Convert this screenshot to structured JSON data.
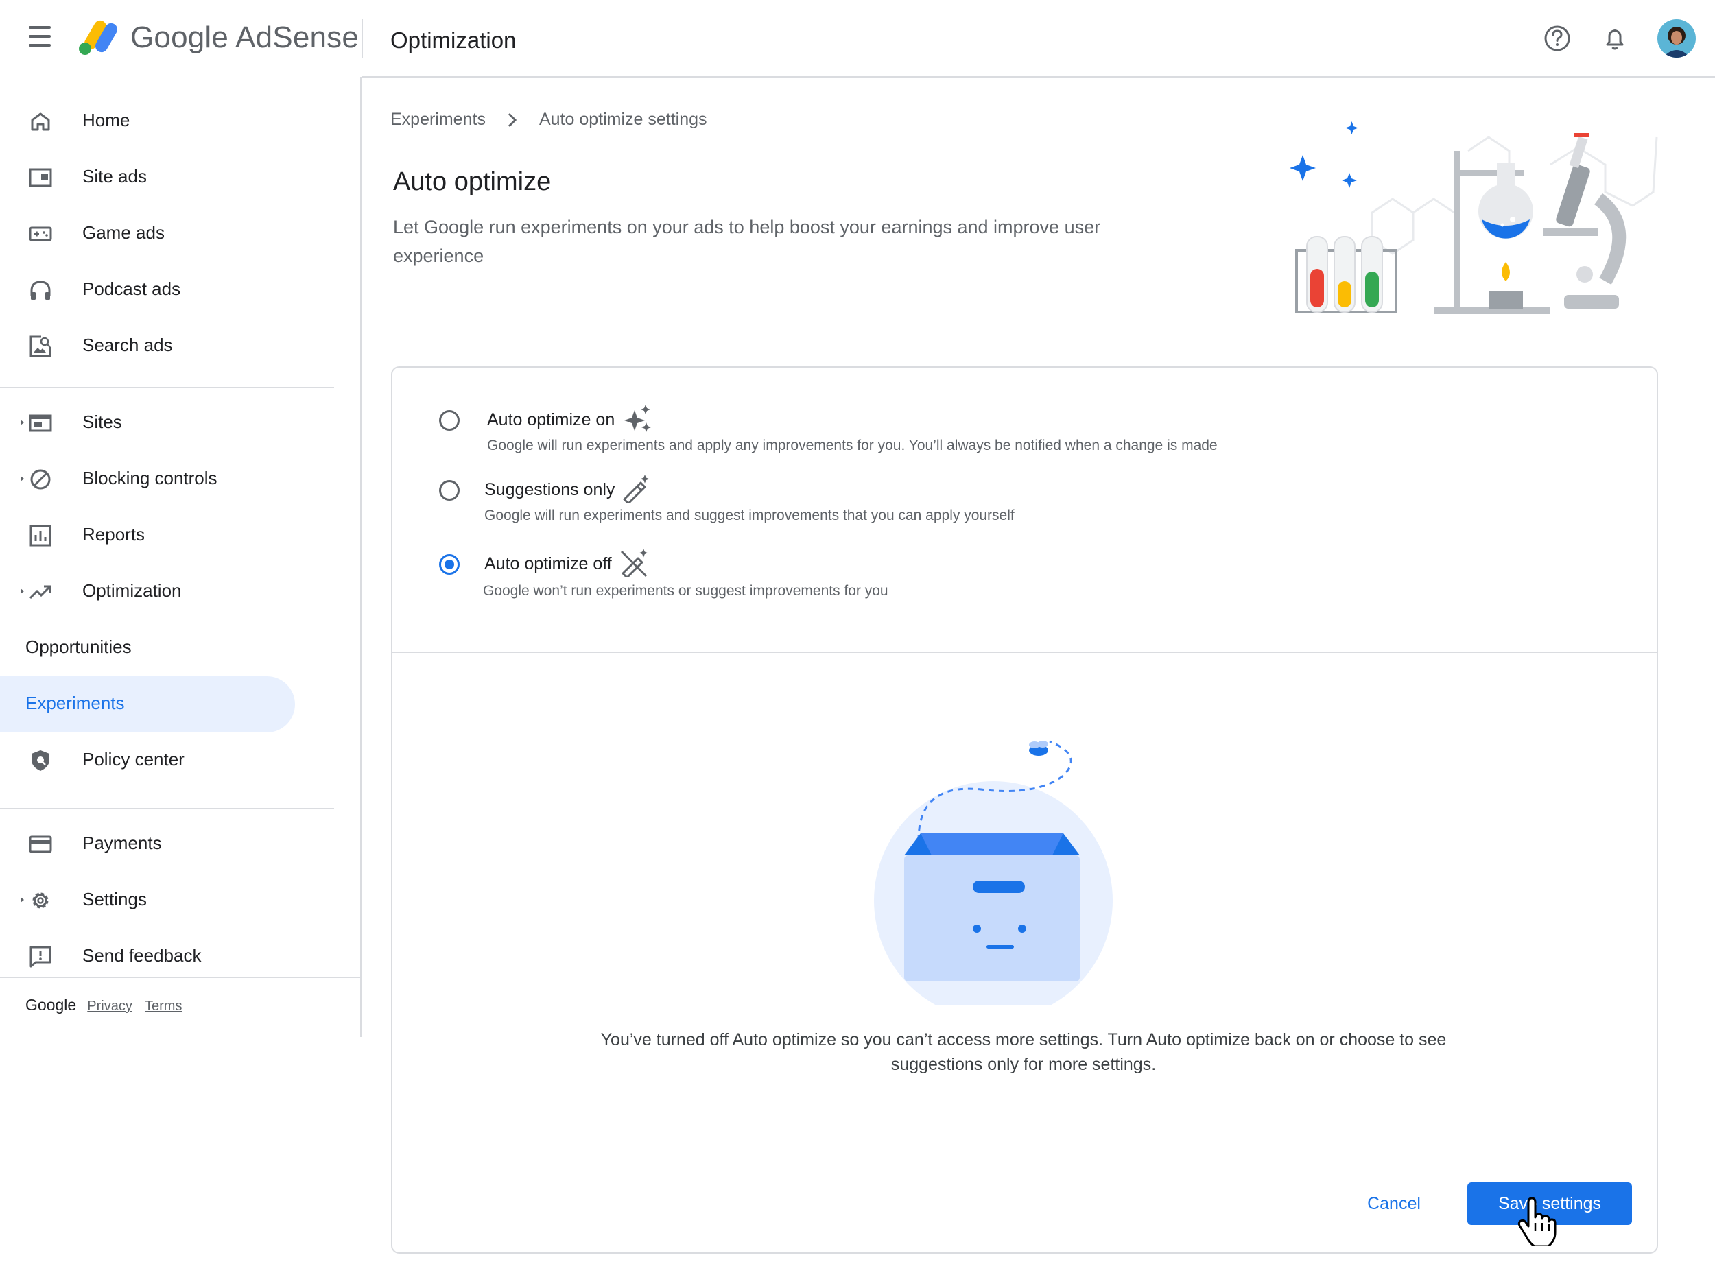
{
  "app": {
    "logo_text": "Google AdSense",
    "page_heading": "Optimization"
  },
  "sidebar": {
    "items": [
      {
        "label": "Home",
        "icon": "home-icon"
      },
      {
        "label": "Site ads",
        "icon": "site-ads-icon"
      },
      {
        "label": "Game ads",
        "icon": "game-ads-icon"
      },
      {
        "label": "Podcast ads",
        "icon": "headphones-icon"
      },
      {
        "label": "Search ads",
        "icon": "search-ads-icon"
      },
      {
        "label": "Sites",
        "icon": "sites-icon"
      },
      {
        "label": "Blocking controls",
        "icon": "block-icon"
      },
      {
        "label": "Reports",
        "icon": "reports-icon"
      },
      {
        "label": "Optimization",
        "icon": "trending-up-icon"
      },
      {
        "label": "Opportunities"
      },
      {
        "label": "Experiments"
      },
      {
        "label": "Policy center",
        "icon": "shield-icon"
      },
      {
        "label": "Payments",
        "icon": "credit-card-icon"
      },
      {
        "label": "Settings",
        "icon": "gear-icon"
      },
      {
        "label": "Send feedback",
        "icon": "feedback-icon"
      }
    ],
    "active": "Experiments"
  },
  "footer": {
    "brand": "Google",
    "privacy": "Privacy",
    "terms": "Terms"
  },
  "breadcrumb": {
    "parent": "Experiments",
    "current": "Auto optimize settings"
  },
  "main": {
    "title": "Auto optimize",
    "subtitle": "Let Google run experiments on your ads to help boost your earnings and improve user experience"
  },
  "options": [
    {
      "label": "Auto optimize on",
      "description": "Google will run experiments and apply any improvements for you. You’ll always be notified when a change is made",
      "icon": "sparkle-icon",
      "selected": false
    },
    {
      "label": "Suggestions only",
      "description": "Google will run experiments and suggest improvements that you can apply yourself",
      "icon": "magic-wand-icon",
      "selected": false
    },
    {
      "label": "Auto optimize off",
      "description": "Google won’t run experiments or suggest improvements for you",
      "icon": "magic-wand-off-icon",
      "selected": true
    }
  ],
  "empty_state": {
    "message": "You’ve turned off Auto optimize so you can’t access more settings. Turn Auto optimize back on or choose to see suggestions only for more settings."
  },
  "actions": {
    "cancel": "Cancel",
    "save": "Save settings"
  },
  "colors": {
    "accent": "#1a73e8",
    "active_bg": "#e8f0fe",
    "text_primary": "#202124",
    "text_secondary": "#5f6368",
    "divider": "#dadce0"
  }
}
